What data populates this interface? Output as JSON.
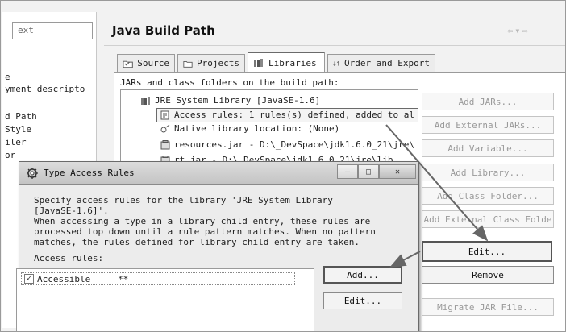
{
  "left_nav": {
    "filter_value": "ext",
    "items": [
      "e",
      "yment descripto",
      "d Path",
      " Style",
      "iler",
      "or"
    ]
  },
  "main": {
    "title": "Java Build Path",
    "tabs": [
      {
        "label": "Source",
        "icon": "source-folder-icon"
      },
      {
        "label": "Projects",
        "icon": "projects-folder-icon"
      },
      {
        "label": "Libraries",
        "icon": "libraries-icon"
      },
      {
        "label": "Order and Export",
        "icon": "order-export-icon"
      }
    ],
    "active_tab": "Libraries",
    "build_path_label": "JARs and class folders on the build path:",
    "tree": {
      "jre": "JRE System Library [JavaSE-1.6]",
      "access_rules": "Access rules: 1 rules(s) defined, added to al",
      "native": "Native library location: (None)",
      "resources": "resources.jar - D:\\_DevSpace\\jdk1.6.0_21\\jre\\",
      "rt": "rt.jar - D:\\_DevSpace\\jdk1.6.0_21\\jre\\lib"
    },
    "buttons": {
      "add_jars": "Add JARs...",
      "add_external_jars": "Add External JARs...",
      "add_variable": "Add Variable...",
      "add_library": "Add Library...",
      "add_class_folder": "Add Class Folder...",
      "add_external_class_folder": "Add External Class Folde",
      "edit": "Edit...",
      "remove": "Remove",
      "migrate": "Migrate JAR File..."
    }
  },
  "dialog": {
    "title": "Type Access Rules",
    "lines": [
      "Specify access rules for the library 'JRE System Library",
      "[JavaSE-1.6]'.",
      "When accessing a type in a library child entry, these rules are",
      "processed top down until a rule pattern matches. When no pattern",
      "matches, the rules defined for library child entry are taken."
    ],
    "rules_label": "Access rules:",
    "rule": {
      "kind": "Accessible",
      "pattern": "**"
    },
    "add_label": "Add...",
    "edit_label": "Edit..."
  }
}
